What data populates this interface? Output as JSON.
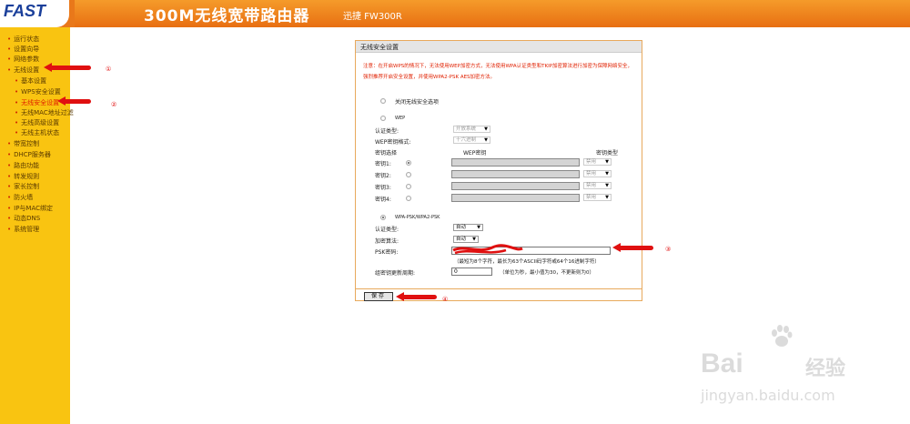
{
  "header": {
    "logo": "FAST",
    "title": "300M无线宽带路由器",
    "model": "迅捷 FW300R"
  },
  "sidebar": {
    "items": [
      {
        "label": "运行状态"
      },
      {
        "label": "设置向导"
      },
      {
        "label": "网络参数"
      },
      {
        "label": "无线设置"
      },
      {
        "label": "基本设置"
      },
      {
        "label": "WPS安全设置"
      },
      {
        "label": "无线安全设置"
      },
      {
        "label": "无线MAC地址过滤"
      },
      {
        "label": "无线高级设置"
      },
      {
        "label": "无线主机状态"
      },
      {
        "label": "带宽控制"
      },
      {
        "label": "DHCP服务器"
      },
      {
        "label": "路由功能"
      },
      {
        "label": "转发规则"
      },
      {
        "label": "家长控制"
      },
      {
        "label": "防火墙"
      },
      {
        "label": "IP与MAC绑定"
      },
      {
        "label": "动态DNS"
      },
      {
        "label": "系统管理"
      }
    ]
  },
  "panel": {
    "title": "无线安全设置",
    "note": "注意：在开启WPS的情况下，无法使用WEP加密方式，无法使用WPA认证类型和TKIP加密算法进行加密为保障网络安全，强烈推荐开启安全设置，并使用WPA2-PSK AES加密方法。",
    "disable_option": "关闭无线安全选项",
    "wep": {
      "label": "WEP",
      "auth_label": "认证类型:",
      "auth_value": "开放系统",
      "format_label": "WEP密钥格式:",
      "format_value": "十六进制",
      "col_select": "密钥选择",
      "col_key": "WEP密钥",
      "col_type": "密钥类型",
      "keys": [
        {
          "label": "密钥1:",
          "type": "禁用"
        },
        {
          "label": "密钥2:",
          "type": "禁用"
        },
        {
          "label": "密钥3:",
          "type": "禁用"
        },
        {
          "label": "密钥4:",
          "type": "禁用"
        }
      ]
    },
    "wpa": {
      "label": "WPA-PSK/WPA2-PSK",
      "auth_label": "认证类型:",
      "auth_value": "自动",
      "algo_label": "加密算法:",
      "algo_value": "自动",
      "psk_label": "PSK密码:",
      "psk_hint": "（最短为8个字符，最长为63个ASCII码字符或64个16进制字符）",
      "rekey_label": "组密钥更新周期:",
      "rekey_value": "0",
      "rekey_hint": "（单位为秒，最小值为30，不更新则为0）"
    },
    "save": "保存"
  },
  "annotations": [
    "①",
    "②",
    "③",
    "④"
  ],
  "watermark": {
    "brand": "Bai",
    "brand2": "经验",
    "url": "jingyan.baidu.com"
  }
}
